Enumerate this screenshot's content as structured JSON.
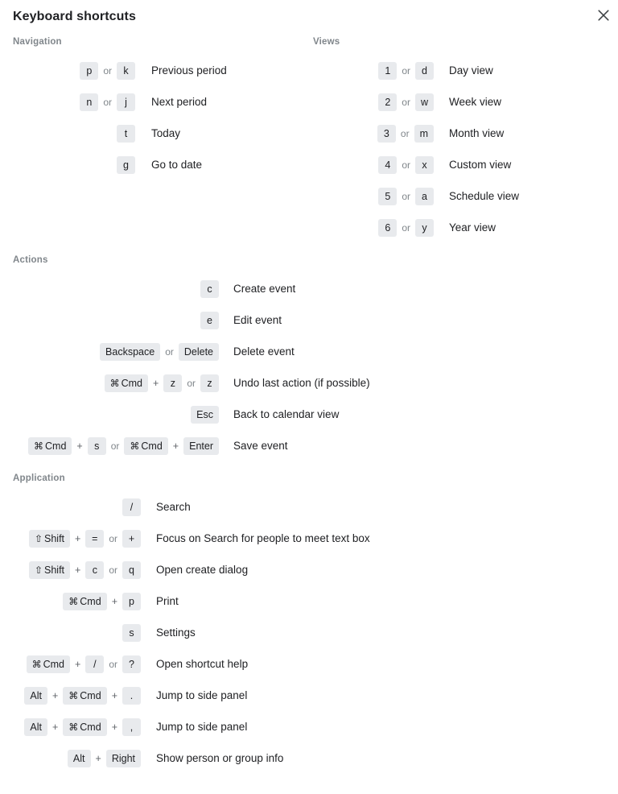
{
  "dialog": {
    "title": "Keyboard shortcuts",
    "close_icon": "close-icon"
  },
  "colors": {
    "chip_background": "#e8eaed",
    "text_primary": "#202124",
    "text_muted": "#80868b",
    "page_background": "#ffffff"
  },
  "separators": {
    "or": "or",
    "plus": "+"
  },
  "symbols": {
    "command": "⌘",
    "shift": "⇧"
  },
  "sections": [
    {
      "id": "navigation",
      "label": "Navigation",
      "rows": [
        {
          "description": "Previous period",
          "keys": [
            {
              "type": "chip",
              "label": "p"
            },
            {
              "type": "sep",
              "label": "or"
            },
            {
              "type": "chip",
              "label": "k"
            }
          ]
        },
        {
          "description": "Next period",
          "keys": [
            {
              "type": "chip",
              "label": "n"
            },
            {
              "type": "sep",
              "label": "or"
            },
            {
              "type": "chip",
              "label": "j"
            }
          ]
        },
        {
          "description": "Today",
          "keys": [
            {
              "type": "chip",
              "label": "t"
            }
          ]
        },
        {
          "description": "Go to date",
          "keys": [
            {
              "type": "chip",
              "label": "g"
            }
          ]
        }
      ]
    },
    {
      "id": "views",
      "label": "Views",
      "rows": [
        {
          "description": "Day view",
          "keys": [
            {
              "type": "chip",
              "label": "1"
            },
            {
              "type": "sep",
              "label": "or"
            },
            {
              "type": "chip",
              "label": "d"
            }
          ]
        },
        {
          "description": "Week view",
          "keys": [
            {
              "type": "chip",
              "label": "2"
            },
            {
              "type": "sep",
              "label": "or"
            },
            {
              "type": "chip",
              "label": "w"
            }
          ]
        },
        {
          "description": "Month view",
          "keys": [
            {
              "type": "chip",
              "label": "3"
            },
            {
              "type": "sep",
              "label": "or"
            },
            {
              "type": "chip",
              "label": "m"
            }
          ]
        },
        {
          "description": "Custom view",
          "keys": [
            {
              "type": "chip",
              "label": "4"
            },
            {
              "type": "sep",
              "label": "or"
            },
            {
              "type": "chip",
              "label": "x"
            }
          ]
        },
        {
          "description": "Schedule view",
          "keys": [
            {
              "type": "chip",
              "label": "5"
            },
            {
              "type": "sep",
              "label": "or"
            },
            {
              "type": "chip",
              "label": "a"
            }
          ]
        },
        {
          "description": "Year view",
          "keys": [
            {
              "type": "chip",
              "label": "6"
            },
            {
              "type": "sep",
              "label": "or"
            },
            {
              "type": "chip",
              "label": "y"
            }
          ]
        }
      ]
    },
    {
      "id": "actions",
      "label": "Actions",
      "rows": [
        {
          "description": "Create event",
          "keys": [
            {
              "type": "chip",
              "label": "c"
            }
          ]
        },
        {
          "description": "Edit event",
          "keys": [
            {
              "type": "chip",
              "label": "e"
            }
          ]
        },
        {
          "description": "Delete event",
          "keys": [
            {
              "type": "chip",
              "label": "Backspace"
            },
            {
              "type": "sep",
              "label": "or"
            },
            {
              "type": "chip",
              "label": "Delete"
            }
          ]
        },
        {
          "description": "Undo last action (if possible)",
          "keys": [
            {
              "type": "chip",
              "label": "Cmd",
              "symbol": "⌘"
            },
            {
              "type": "plus",
              "label": "+"
            },
            {
              "type": "chip",
              "label": "z"
            },
            {
              "type": "sep",
              "label": "or"
            },
            {
              "type": "chip",
              "label": "z"
            }
          ]
        },
        {
          "description": "Back to calendar view",
          "keys": [
            {
              "type": "chip",
              "label": "Esc"
            }
          ]
        },
        {
          "description": "Save event",
          "keys": [
            {
              "type": "chip",
              "label": "Cmd",
              "symbol": "⌘"
            },
            {
              "type": "plus",
              "label": "+"
            },
            {
              "type": "chip",
              "label": "s"
            },
            {
              "type": "sep",
              "label": "or"
            },
            {
              "type": "chip",
              "label": "Cmd",
              "symbol": "⌘"
            },
            {
              "type": "plus",
              "label": "+"
            },
            {
              "type": "chip",
              "label": "Enter"
            }
          ]
        }
      ]
    },
    {
      "id": "application",
      "label": "Application",
      "rows": [
        {
          "description": "Search",
          "keys": [
            {
              "type": "chip",
              "label": "/"
            }
          ]
        },
        {
          "description": "Focus on Search for people to meet text box",
          "keys": [
            {
              "type": "chip",
              "label": "Shift",
              "symbol": "⇧"
            },
            {
              "type": "plus",
              "label": "+"
            },
            {
              "type": "chip",
              "label": "="
            },
            {
              "type": "sep",
              "label": "or"
            },
            {
              "type": "chip",
              "label": "+"
            }
          ]
        },
        {
          "description": "Open create dialog",
          "keys": [
            {
              "type": "chip",
              "label": "Shift",
              "symbol": "⇧"
            },
            {
              "type": "plus",
              "label": "+"
            },
            {
              "type": "chip",
              "label": "c"
            },
            {
              "type": "sep",
              "label": "or"
            },
            {
              "type": "chip",
              "label": "q"
            }
          ]
        },
        {
          "description": "Print",
          "keys": [
            {
              "type": "chip",
              "label": "Cmd",
              "symbol": "⌘"
            },
            {
              "type": "plus",
              "label": "+"
            },
            {
              "type": "chip",
              "label": "p"
            }
          ]
        },
        {
          "description": "Settings",
          "keys": [
            {
              "type": "chip",
              "label": "s"
            }
          ]
        },
        {
          "description": "Open shortcut help",
          "keys": [
            {
              "type": "chip",
              "label": "Cmd",
              "symbol": "⌘"
            },
            {
              "type": "plus",
              "label": "+"
            },
            {
              "type": "chip",
              "label": "/"
            },
            {
              "type": "sep",
              "label": "or"
            },
            {
              "type": "chip",
              "label": "?"
            }
          ]
        },
        {
          "description": "Jump to side panel",
          "keys": [
            {
              "type": "chip",
              "label": "Alt"
            },
            {
              "type": "plus",
              "label": "+"
            },
            {
              "type": "chip",
              "label": "Cmd",
              "symbol": "⌘"
            },
            {
              "type": "plus",
              "label": "+"
            },
            {
              "type": "chip",
              "label": "."
            }
          ]
        },
        {
          "description": "Jump to side panel",
          "keys": [
            {
              "type": "chip",
              "label": "Alt"
            },
            {
              "type": "plus",
              "label": "+"
            },
            {
              "type": "chip",
              "label": "Cmd",
              "symbol": "⌘"
            },
            {
              "type": "plus",
              "label": "+"
            },
            {
              "type": "chip",
              "label": ","
            }
          ]
        },
        {
          "description": "Show person or group info",
          "keys": [
            {
              "type": "chip",
              "label": "Alt"
            },
            {
              "type": "plus",
              "label": "+"
            },
            {
              "type": "chip",
              "label": "Right"
            }
          ]
        }
      ]
    }
  ]
}
